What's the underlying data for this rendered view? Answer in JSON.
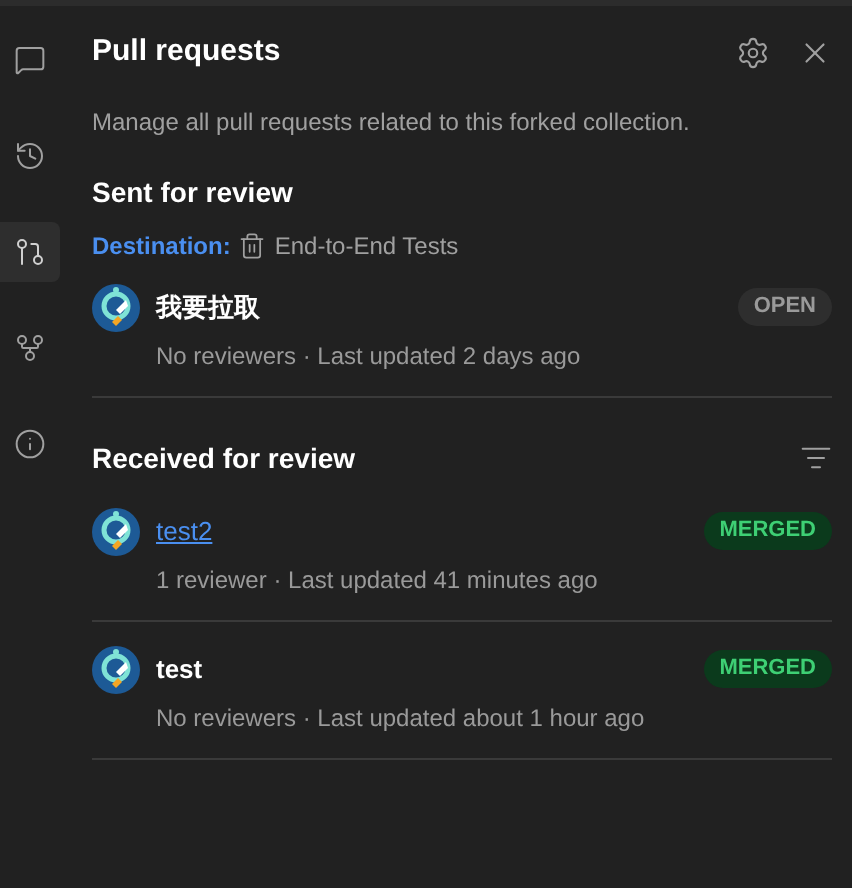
{
  "sidebar": {
    "items": [
      {
        "kind": "comments",
        "selected": false
      },
      {
        "kind": "history",
        "selected": false
      },
      {
        "kind": "pull-requests",
        "selected": true
      },
      {
        "kind": "fork",
        "selected": false
      },
      {
        "kind": "info",
        "selected": false
      }
    ]
  },
  "panel": {
    "title": "Pull requests",
    "description": "Manage all pull requests related to this forked collection."
  },
  "sent": {
    "heading": "Sent for review",
    "destination_label": "Destination:",
    "destination": "End-to-End Tests",
    "requests": [
      {
        "title": "我要拉取",
        "link": false,
        "kind": "open",
        "badge": "OPEN",
        "meta": "No reviewers · Last updated 2 days ago"
      }
    ]
  },
  "received": {
    "heading": "Received for review",
    "requests": [
      {
        "title": "test2",
        "link": true,
        "kind": "merged",
        "badge": "MERGED",
        "meta": "1 reviewer · Last updated 41 minutes ago"
      },
      {
        "title": "test",
        "link": false,
        "kind": "merged",
        "badge": "MERGED",
        "meta": "No reviewers · Last updated about 1 hour ago"
      }
    ]
  }
}
